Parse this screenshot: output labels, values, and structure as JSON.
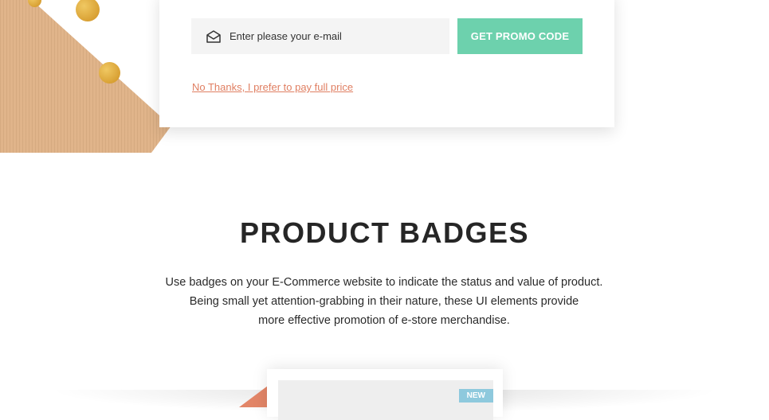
{
  "promo": {
    "email_placeholder": "Enter please your e-mail",
    "button_label": "GET PROMO CODE",
    "decline_link": "No Thanks, I prefer to pay full price"
  },
  "badges_section": {
    "title": "PRODUCT BADGES",
    "description_lines": [
      "Use badges on your E-Commerce website to indicate the status and value of product.",
      "Being small yet attention-grabbing in their nature, these UI elements provide",
      "more effective promotion of e-store merchandise."
    ],
    "product_badge": "NEW"
  },
  "colors": {
    "accent_green": "#6dd1ad",
    "link_coral": "#e07f62",
    "badge_blue": "#8ec9dd",
    "kraft": "#e0b48a"
  },
  "icons": {
    "email": "envelope-icon"
  }
}
